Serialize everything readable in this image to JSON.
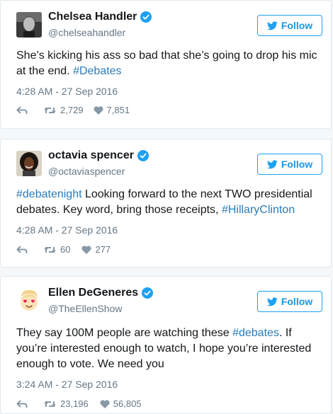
{
  "tweets": [
    {
      "name": "Chelsea Handler",
      "handle": "@chelseahandler",
      "follow_label": "Follow",
      "text_parts": [
        "She’s kicking his ass so bad that she’s going to drop his mic at the end. ",
        "#Debates"
      ],
      "timestamp": "4:28 AM - 27 Sep 2016",
      "retweets": "2,729",
      "likes": "7,851"
    },
    {
      "name": "octavia spencer",
      "handle": "@octaviaspencer",
      "follow_label": "Follow",
      "text_parts": [
        "#debatenight",
        " Looking forward to the next TWO presidential debates. Key word, bring those receipts, ",
        "#HillaryClinton"
      ],
      "timestamp": "4:28 AM - 27 Sep 2016",
      "retweets": "60",
      "likes": "277"
    },
    {
      "name": "Ellen DeGeneres",
      "handle": "@TheEllenShow",
      "follow_label": "Follow",
      "text_parts": [
        "They say 100M people are watching these ",
        "#debates",
        ". If you’re interested enough to watch, I hope you’re interested enough to vote. We need you"
      ],
      "timestamp": "3:24 AM - 27 Sep 2016",
      "retweets": "23,196",
      "likes": "56,805"
    }
  ],
  "colors": {
    "accent": "#1da1f2",
    "link": "#2b7bb9",
    "muted": "#657786",
    "verified": "#1da1f2"
  },
  "icons": [
    "verified-badge-icon",
    "twitter-bird-icon",
    "reply-icon",
    "retweet-icon",
    "heart-icon"
  ]
}
